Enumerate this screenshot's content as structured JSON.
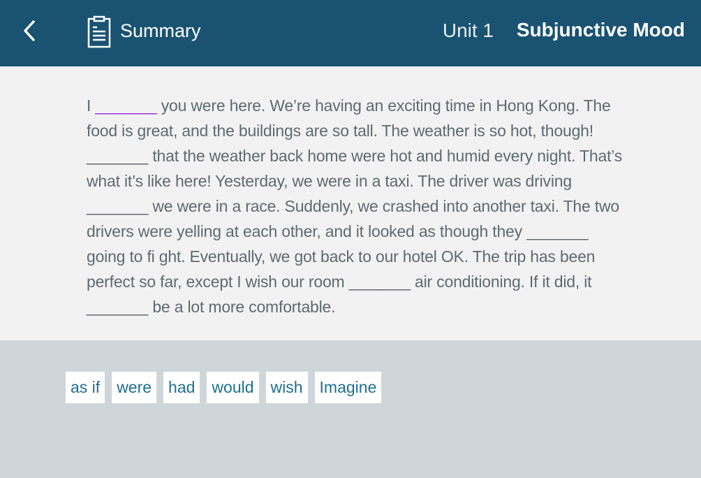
{
  "header": {
    "back_icon": "chevron-left-icon",
    "summary_icon": "clipboard-document-icon",
    "summary_label": "Summary",
    "unit_label": "Unit 1",
    "title": "Subjunctive Mood",
    "background_color": "#1a5272"
  },
  "passage": {
    "blank": "_______",
    "segments": [
      "I ",
      " you were here. We’re having an exciting time in Hong Kong. The food is great, and the buildings are so tall. The weather is so hot, though! ",
      " that the weather back home were hot and humid every night. That’s what it’s like here! Yesterday, we were in a taxi. The driver was driving ",
      " we were in a race. Suddenly, we crashed into another taxi. The two drivers were yelling at each other, and it looked as though they ",
      " going to fi ght. Eventually, we got back to our hotel OK. The trip has been perfect so far, except I wish our room ",
      " air conditioning. If it did, it ",
      " be a lot more comfortable."
    ],
    "active_blank_color": "#9b30d9"
  },
  "word_bank": {
    "words": [
      "as if",
      "were",
      "had",
      "would",
      "wish",
      "Imagine"
    ]
  }
}
